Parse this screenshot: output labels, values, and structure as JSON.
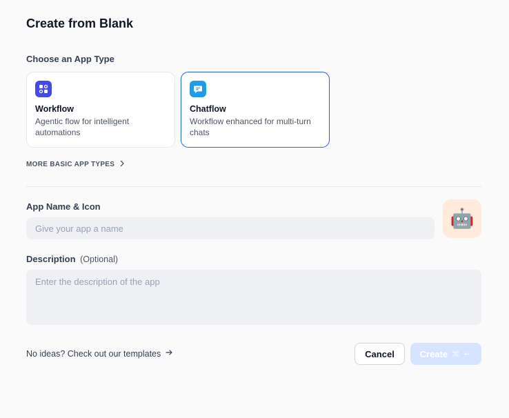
{
  "dialog": {
    "title": "Create from Blank"
  },
  "app_type": {
    "label": "Choose an App Type",
    "options": [
      {
        "name": "Workflow",
        "description": "Agentic flow for intelligent automations",
        "icon": "workflow-icon",
        "color": "#444ce7",
        "selected": false
      },
      {
        "name": "Chatflow",
        "description": "Workflow enhanced for multi-turn chats",
        "icon": "chatflow-icon",
        "color": "#1e9bea",
        "selected": true
      }
    ],
    "more_label": "MORE BASIC APP TYPES"
  },
  "name_section": {
    "label": "App Name & Icon",
    "placeholder": "Give your app a name",
    "value": "",
    "icon_emoji": "🤖",
    "icon_bg": "#ffeadb"
  },
  "description_section": {
    "label": "Description",
    "optional_label": "(Optional)",
    "placeholder": "Enter the description of the app",
    "value": ""
  },
  "footer": {
    "templates_link": "No ideas? Check out our templates",
    "cancel_label": "Cancel",
    "create_label": "Create",
    "create_shortcut": "⌘ ↵"
  },
  "colors": {
    "accent": "#2563eb",
    "create_disabled_bg": "#d6e4ff",
    "input_bg": "#eff0f4"
  }
}
